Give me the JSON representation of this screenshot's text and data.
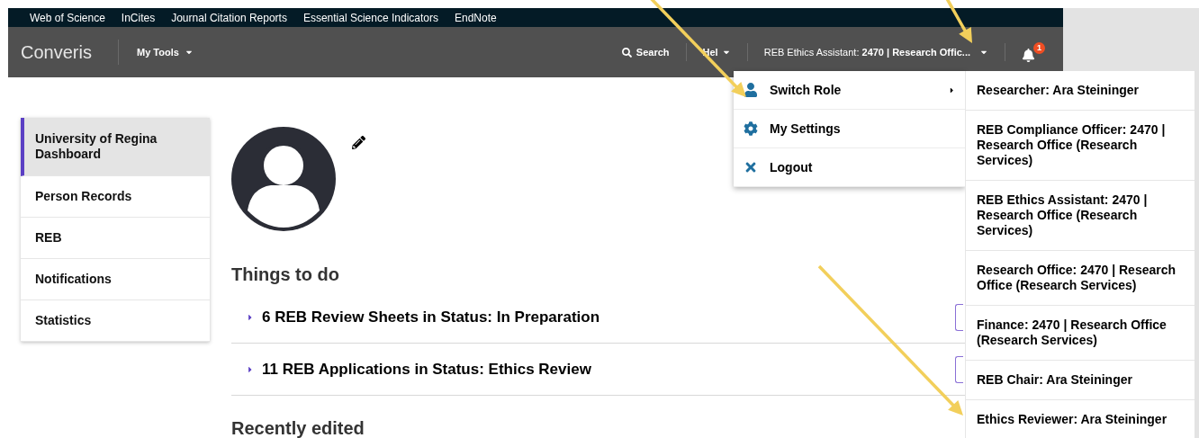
{
  "top_links": [
    "Web of Science",
    "InCites",
    "Journal Citation Reports",
    "Essential Science Indicators",
    "EndNote"
  ],
  "header": {
    "logo": "Converis",
    "my_tools": "My Tools",
    "search": "Search",
    "help": "Hel",
    "role": "REB Ethics Assistant: **2470 | Research Offic...**",
    "notification_count": "1"
  },
  "sidebar": {
    "items": [
      {
        "label": "University of Regina Dashboard",
        "selected": true
      },
      {
        "label": "Person Records",
        "selected": false
      },
      {
        "label": "REB",
        "selected": false
      },
      {
        "label": "Notifications",
        "selected": false
      },
      {
        "label": "Statistics",
        "selected": false
      }
    ]
  },
  "things_to_do": {
    "title": "Things to do",
    "items": [
      {
        "label": "6 REB Review Sheets in Status: In Preparation",
        "expanded": false
      },
      {
        "label": "11 REB Applications in Status: Ethics Review",
        "expanded": false
      }
    ]
  },
  "recently_edited": {
    "title": "Recently edited"
  },
  "user_menu": {
    "items": [
      {
        "kind": "switch-role",
        "label": "Switch Role",
        "has_submenu": true
      },
      {
        "kind": "settings",
        "label": "My Settings",
        "has_submenu": false
      },
      {
        "kind": "logout",
        "label": "Logout",
        "has_submenu": false
      }
    ]
  },
  "role_submenu": {
    "items": [
      "Researcher: Ara Steininger",
      "REB Compliance Officer: 2470 | Research Office (Research Services)",
      "REB Ethics Assistant: 2470 | Research Office (Research Services)",
      "Research Office: 2470 | Research Office (Research Services)",
      "Finance: 2470 | Research Office (Research Services)",
      "REB Chair: Ara Steininger",
      "Ethics Reviewer: Ara Steininger"
    ]
  }
}
